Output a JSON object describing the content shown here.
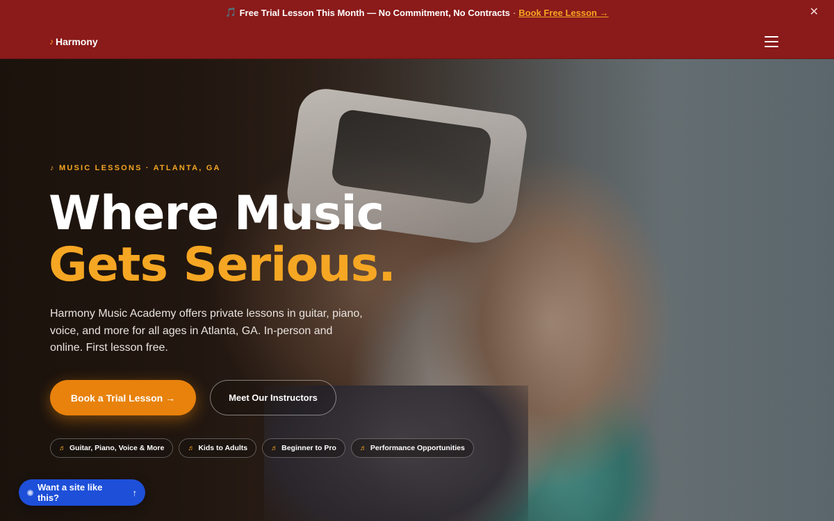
{
  "banner": {
    "note_icon": "music-note-icon",
    "text": "Free Trial Lesson This Month — No Commitment, No Contracts",
    "separator": "·",
    "link_label": "Book Free Lesson →",
    "close_label": "✕"
  },
  "header": {
    "logo_mark": "♪",
    "logo_text": "Harmony",
    "menu_icon": "hamburger-menu-icon"
  },
  "hero": {
    "eyebrow": "♪  MUSIC LESSONS · ATLANTA, GA",
    "title_line1": "Where Music",
    "title_line2": "Gets Serious.",
    "lead": "Harmony Music Academy offers private lessons in guitar, piano, voice, and more for all ages in Atlanta, GA. In-person and online. First lesson free.",
    "primary_button": "Book a Trial Lesson →",
    "secondary_button": "Meet Our Instructors",
    "tags": [
      {
        "icon": "♬",
        "label": "Guitar, Piano, Voice & More"
      },
      {
        "icon": "♬",
        "label": "Kids to Adults"
      },
      {
        "icon": "♬",
        "label": "Beginner to Pro"
      },
      {
        "icon": "♬",
        "label": "Performance Opportunities"
      }
    ]
  },
  "floating_cta": {
    "label": "Want a site like this?",
    "arrow": "↑"
  },
  "colors": {
    "banner_bg": "#8b1a1a",
    "accent": "#f5a623",
    "primary_button": "#e8820c",
    "floating_cta": "#1d4fd8"
  }
}
